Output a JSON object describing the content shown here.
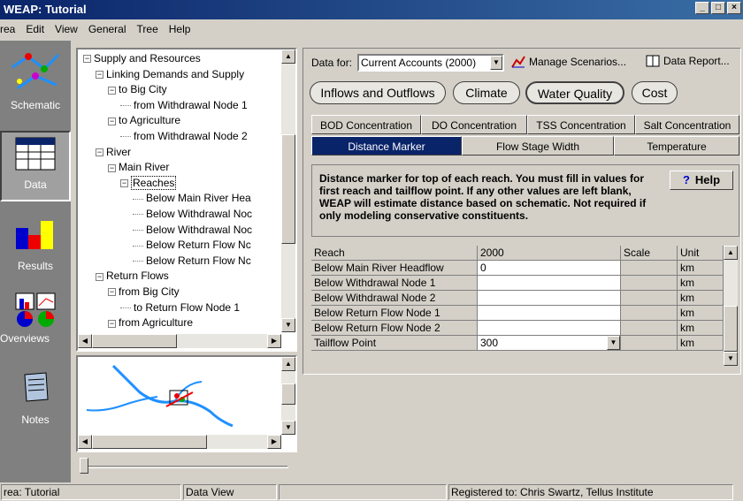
{
  "window": {
    "title": "WEAP: Tutorial"
  },
  "menu": [
    "rea",
    "Edit",
    "View",
    "General",
    "Tree",
    "Help"
  ],
  "nav": {
    "schematic": "Schematic",
    "data": "Data",
    "results": "Results",
    "overviews": "Overviews",
    "notes": "Notes"
  },
  "tree": {
    "nodes": [
      {
        "label": "Supply and Resources",
        "box": "−"
      },
      {
        "label": "Linking Demands and Supply",
        "box": "−"
      },
      {
        "label": "to Big City",
        "box": "−"
      },
      {
        "label": "from Withdrawal Node 1",
        "box": ""
      },
      {
        "label": "to Agriculture",
        "box": "−"
      },
      {
        "label": "from Withdrawal Node 2",
        "box": ""
      },
      {
        "label": "River",
        "box": "−"
      },
      {
        "label": "Main River",
        "box": "−"
      },
      {
        "label": "Reaches",
        "box": "−"
      },
      {
        "label": "Below Main River Hea",
        "box": ""
      },
      {
        "label": "Below Withdrawal Noc",
        "box": ""
      },
      {
        "label": "Below Withdrawal Noc",
        "box": ""
      },
      {
        "label": "Below Return Flow Nc",
        "box": ""
      },
      {
        "label": "Below Return Flow Nc",
        "box": ""
      },
      {
        "label": "Return Flows",
        "box": "−"
      },
      {
        "label": "from Big City",
        "box": "−"
      },
      {
        "label": "to Return Flow Node 1",
        "box": ""
      },
      {
        "label": "from Agriculture",
        "box": "−"
      }
    ]
  },
  "toolbar": {
    "data_for_label": "Data for:",
    "data_for_value": "Current Accounts (2000)",
    "manage_scenarios": "Manage Scenarios...",
    "data_report": "Data Report..."
  },
  "categories": [
    "Inflows and Outflows",
    "Climate",
    "Water Quality",
    "Cost"
  ],
  "tabs_row1": [
    "BOD Concentration",
    "DO Concentration",
    "TSS Concentration",
    "Salt Concentration"
  ],
  "tabs_row2": [
    "Distance Marker",
    "Flow Stage Width",
    "Temperature"
  ],
  "info": {
    "text": "Distance marker for top of each reach.  You must fill in values for first reach and tailflow point.  If any other values are left blank, WEAP will estimate distance based on schematic.  Not required if only modeling conservative constituents.",
    "help": "Help"
  },
  "grid": {
    "headers": [
      "Reach",
      "2000",
      "Scale",
      "Unit"
    ],
    "rows": [
      {
        "reach": "Below Main River Headflow",
        "value": "0",
        "scale": "",
        "unit": "km"
      },
      {
        "reach": "Below Withdrawal Node 1",
        "value": "",
        "scale": "",
        "unit": "km"
      },
      {
        "reach": "Below Withdrawal Node 2",
        "value": "",
        "scale": "",
        "unit": "km"
      },
      {
        "reach": "Below Return Flow Node 1",
        "value": "",
        "scale": "",
        "unit": "km"
      },
      {
        "reach": "Below Return Flow Node 2",
        "value": "",
        "scale": "",
        "unit": "km"
      },
      {
        "reach": "Tailflow Point",
        "value": "300",
        "scale": "",
        "unit": "km"
      }
    ]
  },
  "status": {
    "area": "rea: Tutorial",
    "view": "Data View",
    "registered": "Registered to: Chris Swartz, Tellus Institute"
  }
}
